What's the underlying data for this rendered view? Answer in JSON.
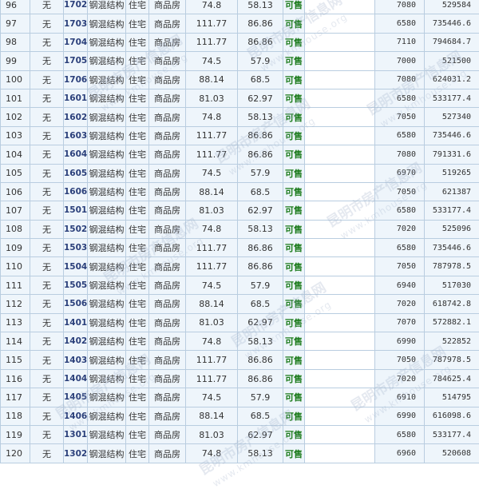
{
  "table": {
    "rows": [
      {
        "idx": "96",
        "none": "无",
        "room": "1702",
        "structure": "钢混结构",
        "use": "住宅",
        "type": "商品房",
        "area": "74.8",
        "inner": "58.13",
        "status": "可售",
        "price": "7080",
        "total": "529584"
      },
      {
        "idx": "97",
        "none": "无",
        "room": "1703",
        "structure": "钢混结构",
        "use": "住宅",
        "type": "商品房",
        "area": "111.77",
        "inner": "86.86",
        "status": "可售",
        "price": "6580",
        "total": "735446.6"
      },
      {
        "idx": "98",
        "none": "无",
        "room": "1704",
        "structure": "钢混结构",
        "use": "住宅",
        "type": "商品房",
        "area": "111.77",
        "inner": "86.86",
        "status": "可售",
        "price": "7110",
        "total": "794684.7"
      },
      {
        "idx": "99",
        "none": "无",
        "room": "1705",
        "structure": "钢混结构",
        "use": "住宅",
        "type": "商品房",
        "area": "74.5",
        "inner": "57.9",
        "status": "可售",
        "price": "7000",
        "total": "521500"
      },
      {
        "idx": "100",
        "none": "无",
        "room": "1706",
        "structure": "钢混结构",
        "use": "住宅",
        "type": "商品房",
        "area": "88.14",
        "inner": "68.5",
        "status": "可售",
        "price": "7080",
        "total": "624031.2"
      },
      {
        "idx": "101",
        "none": "无",
        "room": "1601",
        "structure": "钢混结构",
        "use": "住宅",
        "type": "商品房",
        "area": "81.03",
        "inner": "62.97",
        "status": "可售",
        "price": "6580",
        "total": "533177.4"
      },
      {
        "idx": "102",
        "none": "无",
        "room": "1602",
        "structure": "钢混结构",
        "use": "住宅",
        "type": "商品房",
        "area": "74.8",
        "inner": "58.13",
        "status": "可售",
        "price": "7050",
        "total": "527340"
      },
      {
        "idx": "103",
        "none": "无",
        "room": "1603",
        "structure": "钢混结构",
        "use": "住宅",
        "type": "商品房",
        "area": "111.77",
        "inner": "86.86",
        "status": "可售",
        "price": "6580",
        "total": "735446.6"
      },
      {
        "idx": "104",
        "none": "无",
        "room": "1604",
        "structure": "钢混结构",
        "use": "住宅",
        "type": "商品房",
        "area": "111.77",
        "inner": "86.86",
        "status": "可售",
        "price": "7080",
        "total": "791331.6"
      },
      {
        "idx": "105",
        "none": "无",
        "room": "1605",
        "structure": "钢混结构",
        "use": "住宅",
        "type": "商品房",
        "area": "74.5",
        "inner": "57.9",
        "status": "可售",
        "price": "6970",
        "total": "519265"
      },
      {
        "idx": "106",
        "none": "无",
        "room": "1606",
        "structure": "钢混结构",
        "use": "住宅",
        "type": "商品房",
        "area": "88.14",
        "inner": "68.5",
        "status": "可售",
        "price": "7050",
        "total": "621387"
      },
      {
        "idx": "107",
        "none": "无",
        "room": "1501",
        "structure": "钢混结构",
        "use": "住宅",
        "type": "商品房",
        "area": "81.03",
        "inner": "62.97",
        "status": "可售",
        "price": "6580",
        "total": "533177.4"
      },
      {
        "idx": "108",
        "none": "无",
        "room": "1502",
        "structure": "钢混结构",
        "use": "住宅",
        "type": "商品房",
        "area": "74.8",
        "inner": "58.13",
        "status": "可售",
        "price": "7020",
        "total": "525096"
      },
      {
        "idx": "109",
        "none": "无",
        "room": "1503",
        "structure": "钢混结构",
        "use": "住宅",
        "type": "商品房",
        "area": "111.77",
        "inner": "86.86",
        "status": "可售",
        "price": "6580",
        "total": "735446.6"
      },
      {
        "idx": "110",
        "none": "无",
        "room": "1504",
        "structure": "钢混结构",
        "use": "住宅",
        "type": "商品房",
        "area": "111.77",
        "inner": "86.86",
        "status": "可售",
        "price": "7050",
        "total": "787978.5"
      },
      {
        "idx": "111",
        "none": "无",
        "room": "1505",
        "structure": "钢混结构",
        "use": "住宅",
        "type": "商品房",
        "area": "74.5",
        "inner": "57.9",
        "status": "可售",
        "price": "6940",
        "total": "517030"
      },
      {
        "idx": "112",
        "none": "无",
        "room": "1506",
        "structure": "钢混结构",
        "use": "住宅",
        "type": "商品房",
        "area": "88.14",
        "inner": "68.5",
        "status": "可售",
        "price": "7020",
        "total": "618742.8"
      },
      {
        "idx": "113",
        "none": "无",
        "room": "1401",
        "structure": "钢混结构",
        "use": "住宅",
        "type": "商品房",
        "area": "81.03",
        "inner": "62.97",
        "status": "可售",
        "price": "7070",
        "total": "572882.1"
      },
      {
        "idx": "114",
        "none": "无",
        "room": "1402",
        "structure": "钢混结构",
        "use": "住宅",
        "type": "商品房",
        "area": "74.8",
        "inner": "58.13",
        "status": "可售",
        "price": "6990",
        "total": "522852"
      },
      {
        "idx": "115",
        "none": "无",
        "room": "1403",
        "structure": "钢混结构",
        "use": "住宅",
        "type": "商品房",
        "area": "111.77",
        "inner": "86.86",
        "status": "可售",
        "price": "7050",
        "total": "787978.5"
      },
      {
        "idx": "116",
        "none": "无",
        "room": "1404",
        "structure": "钢混结构",
        "use": "住宅",
        "type": "商品房",
        "area": "111.77",
        "inner": "86.86",
        "status": "可售",
        "price": "7020",
        "total": "784625.4"
      },
      {
        "idx": "117",
        "none": "无",
        "room": "1405",
        "structure": "钢混结构",
        "use": "住宅",
        "type": "商品房",
        "area": "74.5",
        "inner": "57.9",
        "status": "可售",
        "price": "6910",
        "total": "514795"
      },
      {
        "idx": "118",
        "none": "无",
        "room": "1406",
        "structure": "钢混结构",
        "use": "住宅",
        "type": "商品房",
        "area": "88.14",
        "inner": "68.5",
        "status": "可售",
        "price": "6990",
        "total": "616098.6"
      },
      {
        "idx": "119",
        "none": "无",
        "room": "1301",
        "structure": "钢混结构",
        "use": "住宅",
        "type": "商品房",
        "area": "81.03",
        "inner": "62.97",
        "status": "可售",
        "price": "6580",
        "total": "533177.4"
      },
      {
        "idx": "120",
        "none": "无",
        "room": "1302",
        "structure": "钢混结构",
        "use": "住宅",
        "type": "商品房",
        "area": "74.8",
        "inner": "58.13",
        "status": "可售",
        "price": "6960",
        "total": "520608"
      }
    ]
  },
  "watermark": {
    "cn": "昆明市房产信息网",
    "en": "www.kmhouse.org"
  },
  "colors": {
    "row_bg": "#eef5fb",
    "border": "#b9cde0",
    "room_text": "#2a3f7a",
    "status_text": "#1a7a1a"
  }
}
